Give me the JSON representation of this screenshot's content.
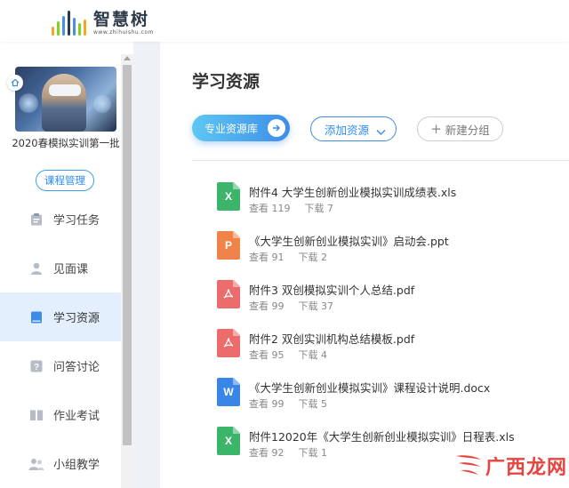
{
  "header": {
    "logo_name": "智慧树",
    "logo_url": "www.zhihuishu.com"
  },
  "sidebar": {
    "course_title": "2020春模拟实训第一批",
    "manage_button": "课程管理",
    "items": [
      {
        "label": "学习任务",
        "icon": "clipboard-icon",
        "active": false
      },
      {
        "label": "见面课",
        "icon": "person-icon",
        "active": false
      },
      {
        "label": "学习资源",
        "icon": "book-icon",
        "active": true
      },
      {
        "label": "问答讨论",
        "icon": "question-icon",
        "active": false
      },
      {
        "label": "作业考试",
        "icon": "open-book-icon",
        "active": false
      },
      {
        "label": "小组教学",
        "icon": "group-icon",
        "active": false
      }
    ]
  },
  "main": {
    "title": "学习资源",
    "primary_button": "专业资源库",
    "add_button": "添加资源",
    "new_group_button": "新建分组",
    "files": [
      {
        "name": "附件4 大学生创新创业模拟实训成绩表.xls",
        "type": "xls",
        "views": "查看 119",
        "downloads": "下载 7"
      },
      {
        "name": "《大学生创新创业模拟实训》启动会.ppt",
        "type": "ppt",
        "views": "查看 91",
        "downloads": "下载 2"
      },
      {
        "name": "附件3 双创模拟实训个人总结.pdf",
        "type": "pdf",
        "views": "查看 99",
        "downloads": "下载 37"
      },
      {
        "name": "附件2 双创实训机构总结模板.pdf",
        "type": "pdf",
        "views": "查看 95",
        "downloads": "下载 4"
      },
      {
        "name": "《大学生创新创业模拟实训》课程设计说明.docx",
        "type": "docx",
        "views": "查看 99",
        "downloads": "下载 5"
      },
      {
        "name": "附件12020年《大学生创新创业模拟实训》日程表.xls",
        "type": "xls",
        "views": "查看 92",
        "downloads": "下载 1"
      }
    ]
  },
  "watermark": {
    "text": "广西龙网"
  },
  "colors": {
    "accent": "#2d8cf0",
    "xls": "#3cb56a",
    "ppt": "#f0834a",
    "pdf": "#ec6b6b",
    "docx": "#3a86e6",
    "active_nav_bg": "#e3effc"
  }
}
